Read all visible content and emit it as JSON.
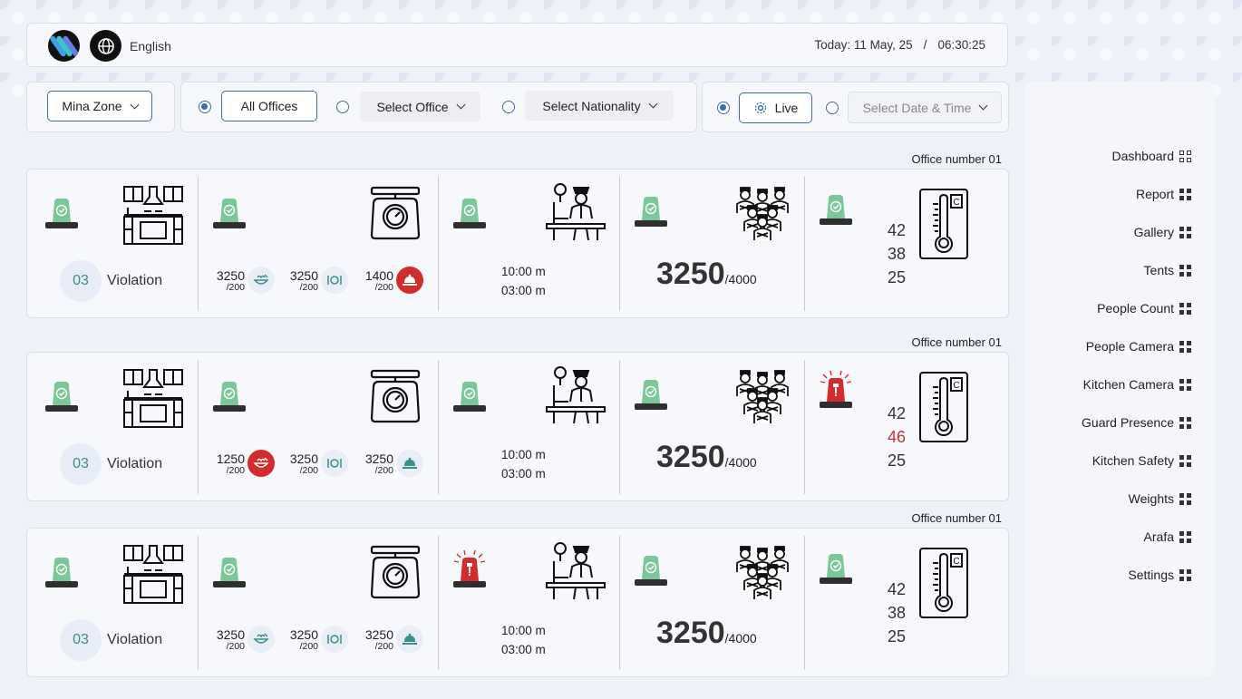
{
  "header": {
    "language": "English",
    "date_text": "Today: 11 May, 25",
    "separator": "/",
    "time_text": "06:30:25"
  },
  "filters": {
    "zone": "Mina Zone",
    "all_offices": "All Offices",
    "select_office": "Select Office",
    "select_nationality": "Select Nationality",
    "live": "Live",
    "date_time_placeholder": "Select Date & Time",
    "selected_scope": "all_offices",
    "selected_mode": "live"
  },
  "offices": [
    {
      "label": "Office number 01",
      "violation_count": "03",
      "violation_label": "Violation",
      "kitchen_alert": false,
      "weights_alert": false,
      "guard_alert": false,
      "people_alert": false,
      "temp_alert": false,
      "meals": [
        {
          "value": "3250",
          "limit": "/200",
          "icon": "food-bowl-icon",
          "alert": false
        },
        {
          "value": "3250",
          "limit": "/200",
          "icon": "plate-cutlery-icon",
          "alert": false
        },
        {
          "value": "1400",
          "limit": "/200",
          "icon": "cloche-icon",
          "alert": true
        }
      ],
      "time_in": "10:00 m",
      "time_out": "03:00 m",
      "count": "3250",
      "capacity": "/4000",
      "temps": [
        "42",
        "38",
        "25"
      ],
      "temp_alert_index": -1
    },
    {
      "label": "Office number 01",
      "violation_count": "03",
      "violation_label": "Violation",
      "kitchen_alert": false,
      "weights_alert": false,
      "guard_alert": false,
      "people_alert": false,
      "temp_alert": true,
      "meals": [
        {
          "value": "1250",
          "limit": "/200",
          "icon": "food-bowl-icon",
          "alert": true
        },
        {
          "value": "3250",
          "limit": "/200",
          "icon": "plate-cutlery-icon",
          "alert": false
        },
        {
          "value": "3250",
          "limit": "/200",
          "icon": "cloche-icon",
          "alert": false
        }
      ],
      "time_in": "10:00 m",
      "time_out": "03:00 m",
      "count": "3250",
      "capacity": "/4000",
      "temps": [
        "42",
        "46",
        "25"
      ],
      "temp_alert_index": 1
    },
    {
      "label": "Office number 01",
      "violation_count": "03",
      "violation_label": "Violation",
      "kitchen_alert": false,
      "weights_alert": false,
      "guard_alert": true,
      "people_alert": false,
      "temp_alert": false,
      "meals": [
        {
          "value": "3250",
          "limit": "/200",
          "icon": "food-bowl-icon",
          "alert": false
        },
        {
          "value": "3250",
          "limit": "/200",
          "icon": "plate-cutlery-icon",
          "alert": false
        },
        {
          "value": "3250",
          "limit": "/200",
          "icon": "cloche-icon",
          "alert": false
        }
      ],
      "time_in": "10:00 m",
      "time_out": "03:00 m",
      "count": "3250",
      "capacity": "/4000",
      "temps": [
        "42",
        "38",
        "25"
      ],
      "temp_alert_index": -1
    }
  ],
  "sidebar": {
    "items": [
      {
        "label": "Dashboard",
        "icon": "dashboard-icon",
        "active": true
      },
      {
        "label": "Report",
        "icon": "grid-icon"
      },
      {
        "label": "Gallery",
        "icon": "grid-icon"
      },
      {
        "label": "Tents",
        "icon": "grid-icon"
      },
      {
        "label": "People Count",
        "icon": "grid-icon"
      },
      {
        "label": "People Camera",
        "icon": "grid-icon"
      },
      {
        "label": "Kitchen Camera",
        "icon": "grid-icon"
      },
      {
        "label": "Guard Presence",
        "icon": "grid-icon"
      },
      {
        "label": "Kitchen Safety",
        "icon": "grid-icon"
      },
      {
        "label": "Weights",
        "icon": "grid-icon"
      },
      {
        "label": "Arafa",
        "icon": "grid-icon"
      },
      {
        "label": "Settings",
        "icon": "grid-icon"
      }
    ]
  },
  "colors": {
    "accent": "#3d6ab3",
    "ok_green": "#7cc79a",
    "alert_red": "#d22d2d",
    "teal": "#3b8f86"
  }
}
